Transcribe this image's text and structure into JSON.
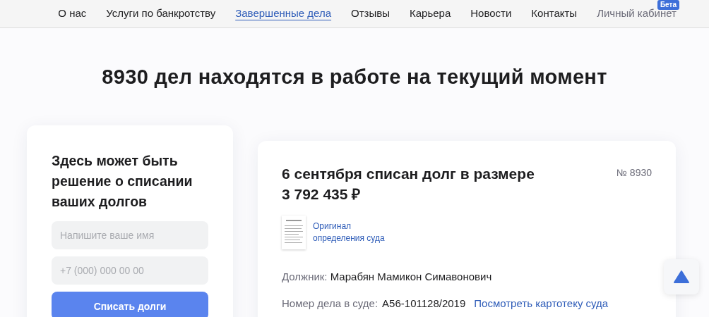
{
  "nav": {
    "items": [
      {
        "label": "О нас",
        "selected": false
      },
      {
        "label": "Услуги по банкротству",
        "selected": false
      },
      {
        "label": "Завершенные дела",
        "selected": true
      },
      {
        "label": "Отзывы",
        "selected": false
      },
      {
        "label": "Карьера",
        "selected": false
      },
      {
        "label": "Новости",
        "selected": false
      },
      {
        "label": "Контакты",
        "selected": false
      }
    ],
    "account": {
      "label": "Личный кабинет",
      "badge": "Бета"
    }
  },
  "headline": "8930 дел находятся в работе на текущий момент",
  "form": {
    "title": "Здесь может быть решение о списании ваших долгов",
    "name_field": {
      "placeholder": "Напишите ваше имя"
    },
    "phone_field": {
      "placeholder": "+7 (000) 000 00 00"
    },
    "submit": "Списать долги"
  },
  "case": {
    "title": "6 сентября списан долг в размере",
    "amount": "3 792 435 ₽",
    "number": "№ 8930",
    "document_link": "Оригинал определения суда",
    "debtor_label": "Должник:",
    "debtor": "Марабян Мамикон Симавонович",
    "case_label": "Номер дела в суде:",
    "case_number": "А56-101128/2019",
    "case_link": "Посмотреть картотеку суда"
  }
}
